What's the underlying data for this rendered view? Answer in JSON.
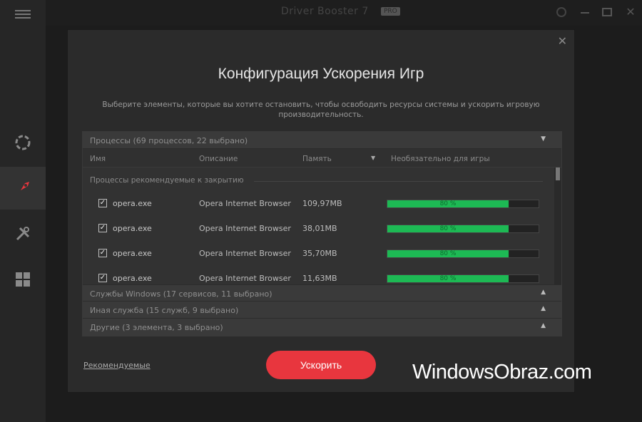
{
  "app": {
    "title": "Driver Booster 7",
    "version": "PRO",
    "close_glyph": "✕"
  },
  "modal": {
    "close_glyph": "✕",
    "title": "Конфигурация Ускорения Игр",
    "description": "Выберите элементы, которые вы хотите остановить, чтобы освободить ресурсы системы и ускорить игровую производительность.",
    "sections": [
      {
        "label": "Процессы (69 процессов, 22 выбрано)",
        "expanded": true
      },
      {
        "label": "Службы Windows (17 сервисов, 11 выбрано)",
        "expanded": false
      },
      {
        "label": "Иная служба (15 служб, 9 выбрано)",
        "expanded": false
      },
      {
        "label": "Другие (3 элемента, 3 выбрано)",
        "expanded": false
      }
    ],
    "columns": {
      "name": "Имя",
      "description": "Описание",
      "memory": "Память",
      "required": "Необязательно для игры"
    },
    "group_label": "Процессы рекомендуемые к закрытию",
    "rows": [
      {
        "checked": true,
        "name": "opera.exe",
        "description": "Opera Internet Browser",
        "memory": "109,97MB",
        "percent": 80,
        "percent_label": "80 %"
      },
      {
        "checked": true,
        "name": "opera.exe",
        "description": "Opera Internet Browser",
        "memory": "38,01MB",
        "percent": 80,
        "percent_label": "80 %"
      },
      {
        "checked": true,
        "name": "opera.exe",
        "description": "Opera Internet Browser",
        "memory": "35,70MB",
        "percent": 80,
        "percent_label": "80 %"
      },
      {
        "checked": true,
        "name": "opera.exe",
        "description": "Opera Internet Browser",
        "memory": "11,63MB",
        "percent": 80,
        "percent_label": "80 %"
      }
    ],
    "footer_link": "Рекомендуемые",
    "accelerate_button": "Ускорить"
  },
  "watermark": "WindowsObraz.com",
  "colors": {
    "accent": "#e8363e",
    "progress": "#1db954",
    "background": "#2b2b2b"
  }
}
